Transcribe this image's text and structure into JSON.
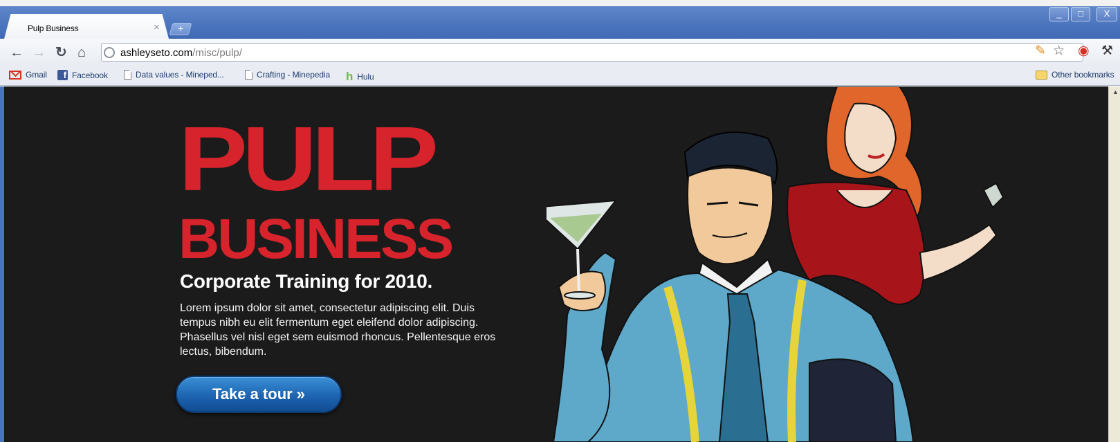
{
  "browser": {
    "tab_title": "Pulp Business",
    "tab_close": "×",
    "new_tab": "+",
    "window_controls": [
      "_",
      "□",
      "X"
    ],
    "url_host": "ashleyseto.com",
    "url_path": "/misc/pulp/",
    "nav_icons": [
      "back-arrow-icon",
      "forward-arrow-icon",
      "reload-icon",
      "home-icon"
    ],
    "toolbar_icons": [
      "extension-icon",
      "bookmark-star-icon",
      "adblock-icon",
      "wrench-icon"
    ]
  },
  "bookmarks": {
    "items": [
      {
        "label": "Gmail",
        "icon": "gmail-icon"
      },
      {
        "label": "Facebook",
        "icon": "facebook-icon"
      },
      {
        "label": "Data values - Mineped...",
        "icon": "page-icon"
      },
      {
        "label": "Crafting - Minepedia",
        "icon": "page-icon"
      },
      {
        "label": "Hulu",
        "icon": "hulu-icon"
      }
    ],
    "other": "Other bookmarks"
  },
  "page": {
    "title_line1": "PULP",
    "title_line2": "BUSINESS",
    "tagline": "Corporate Training for 2010.",
    "body": "Lorem ipsum dolor sit amet, consectetur adipiscing elit. Duis tempus nibh eu elit fermentum eget eleifend dolor adipiscing. Phasellus vel nisl eget sem euismod rhoncus. Pellentesque eros lectus, bibendum.",
    "cta": "Take a tour »"
  },
  "colors": {
    "background": "#1b1b1b",
    "title_red": "#d7232b",
    "button_blue": "#1d64b2",
    "chrome_blue": "#4a74bd"
  }
}
